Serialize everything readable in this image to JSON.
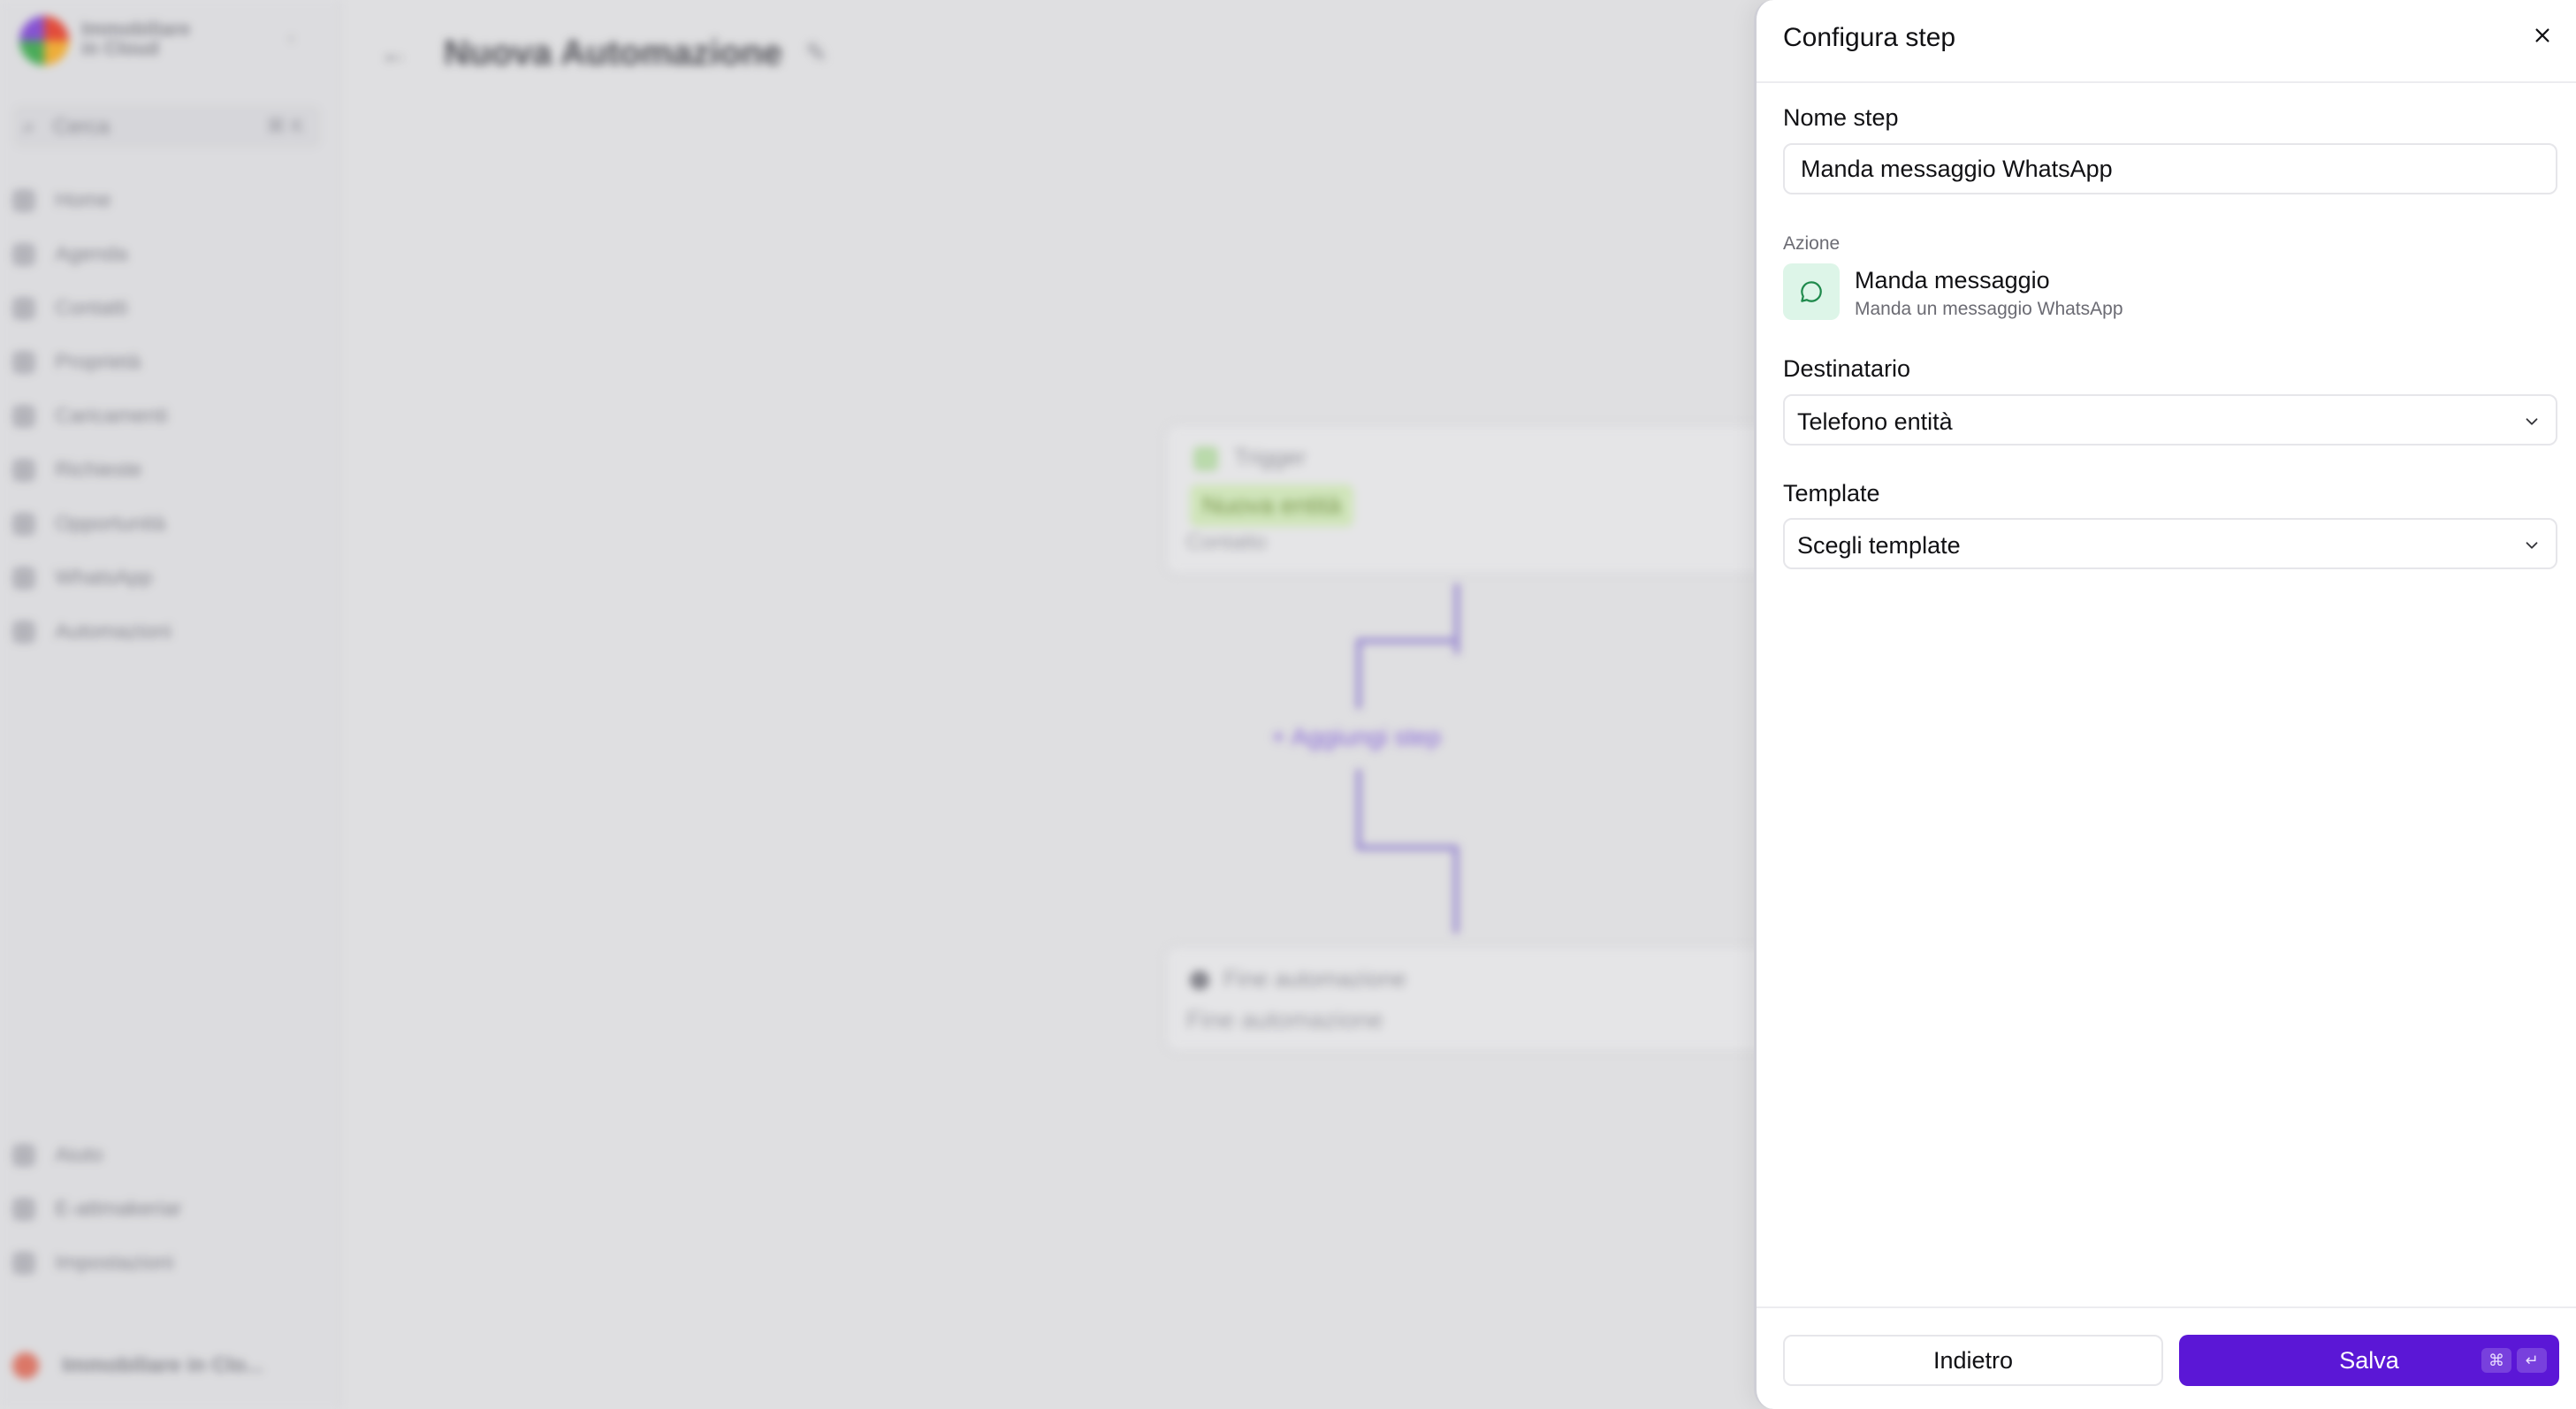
{
  "background": {
    "logo_text_line1": "Immobiliare",
    "logo_text_line2": "in Cloud",
    "search": {
      "label": "Cerca",
      "shortcut": "⌘ K"
    },
    "nav": [
      {
        "label": "Home",
        "icon": "home-icon"
      },
      {
        "label": "Agenda",
        "icon": "calendar-icon"
      },
      {
        "label": "Contatti",
        "icon": "contact-icon"
      },
      {
        "label": "Proprietà",
        "icon": "building-icon"
      },
      {
        "label": "Caricamenti",
        "icon": "upload-icon"
      },
      {
        "label": "Richieste",
        "icon": "request-icon"
      },
      {
        "label": "Opportunità",
        "icon": "opportunity-icon"
      },
      {
        "label": "WhatsApp",
        "icon": "whatsapp-icon"
      },
      {
        "label": "Automazioni",
        "icon": "automation-icon"
      }
    ],
    "bottom_nav": [
      {
        "label": "Aiuto",
        "icon": "help-icon"
      },
      {
        "label": "E-attmakeriar",
        "icon": "external-icon"
      },
      {
        "label": "Impostazioni",
        "icon": "settings-icon"
      }
    ],
    "user_label": "Immobiliare in Clo...",
    "page_title": "Nuova Automazione",
    "trigger_card": {
      "label": "Trigger",
      "badge": "Nuova entità",
      "sub": "Contatto"
    },
    "add_step": "+ Aggiungi step",
    "end_card": {
      "label": "Fine automazione",
      "sub": "Fine automazione"
    }
  },
  "panel": {
    "title": "Configura step",
    "name_label": "Nome step",
    "name_value": "Manda messaggio WhatsApp",
    "action_caption": "Azione",
    "action_title": "Manda messaggio",
    "action_subtitle": "Manda un messaggio WhatsApp",
    "recipient_label": "Destinatario",
    "recipient_value": "Telefono entità",
    "template_label": "Template",
    "template_value": "Scegli template",
    "back_label": "Indietro",
    "save_label": "Salva",
    "save_kbd_1": "⌘",
    "save_kbd_2": "↵"
  },
  "colors": {
    "accent": "#5b17d6",
    "action_icon_bg": "#ddf5e8",
    "action_icon_fg": "#1f8a4c",
    "connector": "#9e8ed6"
  }
}
